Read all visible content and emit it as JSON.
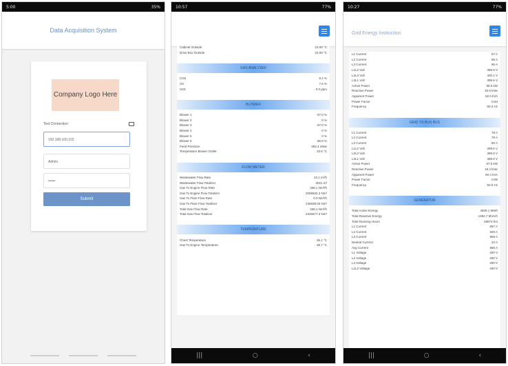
{
  "phone1": {
    "status_left": "5:00",
    "status_right": "35%",
    "app_title": "Data Acquisition System",
    "logo_text": "Company Logo Here",
    "test_connection": "Test Connection",
    "ip_value": "192.168.100.102",
    "username": "Admin",
    "password": "••••••",
    "login_button": "Submit"
  },
  "phone2": {
    "status_left": "10:57",
    "status_right": "77%",
    "top_rows": [
      {
        "label": "Cabinet Outside",
        "value": "23.00 °C"
      },
      {
        "label": "Drive Box Outside",
        "value": "23.00 °C"
      }
    ],
    "sections": [
      {
        "title": "GAS ANALYZER",
        "rows": [
          {
            "label": "CO2",
            "value": "8.4 %"
          },
          {
            "label": "O2",
            "value": "7.6 %"
          },
          {
            "label": "H2S",
            "value": "0.0 ppm"
          }
        ]
      },
      {
        "title": "BLOWER",
        "rows": [
          {
            "label": "Blower 1",
            "value": "87.0 %"
          },
          {
            "label": "Blower 2",
            "value": "0 %"
          },
          {
            "label": "Blower 3",
            "value": "87.0 %"
          },
          {
            "label": "Blower 4",
            "value": "0 %"
          },
          {
            "label": "Blower 5",
            "value": "0 %"
          },
          {
            "label": "Blower 6",
            "value": "86.8 %"
          },
          {
            "label": "Feed Pressure",
            "value": "384.4 mbar"
          },
          {
            "label": "Temperature Blower Outlet",
            "value": "33.6 °C"
          }
        ]
      },
      {
        "title": "FLOW METER",
        "rows": [
          {
            "label": "Wastewater Flow Rate",
            "value": "23.1 m³/h"
          },
          {
            "label": "Wastewater Flow Totalizer",
            "value": "3021 m³"
          },
          {
            "label": "Gas To Engine Flow Rate",
            "value": "338.1 Nm³/h"
          },
          {
            "label": "Gas To Engine Flow Totalizer",
            "value": "2005832.2 Nm³"
          },
          {
            "label": "Gas To Flare Flow Rate",
            "value": "0.0 Nm³/h"
          },
          {
            "label": "Gas To Flare Flow Totalizer",
            "value": "246838.00 Nm³"
          },
          {
            "label": "Total Gas Flow Rate",
            "value": "338.1 Nm³/h"
          },
          {
            "label": "Total Gas Flow Totalizer",
            "value": "2345577.3 Nm³"
          }
        ]
      },
      {
        "title": "TEMPERATURE",
        "rows": [
          {
            "label": "Chest Temperature",
            "value": "36.1 °C"
          },
          {
            "label": "Gas To Engine Temperature",
            "value": "36.7 °C"
          }
        ]
      }
    ]
  },
  "phone3": {
    "status_left": "10:27",
    "status_right": "77%",
    "app_title": "Grid Energy Instruction",
    "top_rows": [
      {
        "label": "L1 Current",
        "value": "87 A"
      },
      {
        "label": "L2 Current",
        "value": "86 A"
      },
      {
        "label": "L3 Current",
        "value": "86 A"
      },
      {
        "label": "L1L2 Volt",
        "value": "399.9 V"
      },
      {
        "label": "L2L3 Volt",
        "value": "400.1 V"
      },
      {
        "label": "L3L1 Volt",
        "value": "399.5 V"
      },
      {
        "label": "Active Power",
        "value": "58.6 kW"
      },
      {
        "label": "Reactive Power",
        "value": "20.6 kVar"
      },
      {
        "label": "Apparent Power",
        "value": "62.0 kVA"
      },
      {
        "label": "Power Factor",
        "value": "0.94"
      },
      {
        "label": "Frequency",
        "value": "50.0 Hz"
      }
    ],
    "sections": [
      {
        "title": "GRID TO BUS BUS",
        "rows": [
          {
            "label": "L1 Current",
            "value": "78 A"
          },
          {
            "label": "L2 Current",
            "value": "78 A"
          },
          {
            "label": "L3 Current",
            "value": "80 A"
          },
          {
            "label": "L1L2 Volt",
            "value": "399.6 V"
          },
          {
            "label": "L2L3 Volt",
            "value": "399.8 V"
          },
          {
            "label": "L3L1 Volt",
            "value": "398.9 V"
          },
          {
            "label": "Active Power",
            "value": "57.6 kW"
          },
          {
            "label": "Reactive Power",
            "value": "18.4 kVar"
          },
          {
            "label": "Apparent Power",
            "value": "60.4 kVA"
          },
          {
            "label": "Power Factor",
            "value": "0.95"
          },
          {
            "label": "Frequency",
            "value": "50.0 Hz"
          }
        ]
      },
      {
        "title": "GENERATOR",
        "rows": [
          {
            "label": "Total Active Energy",
            "value": "4839.1 MWh"
          },
          {
            "label": "Total Reactive Energy",
            "value": "1382.7 MVArh"
          },
          {
            "label": "Total Running Hours",
            "value": "28874 hrs"
          },
          {
            "label": "L1 Current",
            "value": "857 A"
          },
          {
            "label": "L2 Current",
            "value": "849 A"
          },
          {
            "label": "L3 Current",
            "value": "858 A"
          },
          {
            "label": "Neutral Current",
            "value": "22 A"
          },
          {
            "label": "Avg Current",
            "value": "855 A"
          },
          {
            "label": "L1 Voltage",
            "value": "400 V"
          },
          {
            "label": "L2 Voltage",
            "value": "400 V"
          },
          {
            "label": "L3 Voltage",
            "value": "400 V"
          },
          {
            "label": "L1L2 Voltage",
            "value": "400 V"
          }
        ]
      }
    ]
  }
}
